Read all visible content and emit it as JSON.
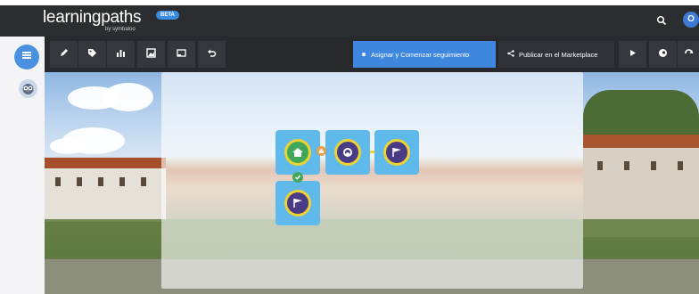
{
  "header": {
    "logo": "learningpaths",
    "logo_sub": "by symbaloo",
    "beta": "BETA",
    "avatar_letter": "O"
  },
  "toolbar": {
    "assign_label": "Asignar y Comenzar seguimiento",
    "publish_label": "Publicar en el Marketplace"
  },
  "icons": {
    "sidebar_menu": "grid-icon",
    "sidebar_avatar": "owl-avatar-icon",
    "search": "search-icon",
    "edit": "pencil-icon",
    "tag": "tag-icon",
    "stats": "bar-chart-icon",
    "image": "image-icon",
    "layout": "window-icon",
    "undo": "undo-icon",
    "share": "share-icon",
    "play": "play-icon",
    "palette": "palette-icon",
    "more": "refresh-icon",
    "home_tile": "home-icon",
    "avatar_tile": "avatar-icon",
    "flag_tile": "flag-icon",
    "check": "check-icon",
    "hand": "hand-cursor-icon"
  },
  "colors": {
    "header_bg": "#2b2d30",
    "toolbar_bg": "#27292d",
    "accent_blue": "#3f87de",
    "tile_blue": "#5fb9ea",
    "ring_yellow": "#ecd332",
    "home_green": "#41a85a",
    "flag_purple": "#4a3b87"
  }
}
